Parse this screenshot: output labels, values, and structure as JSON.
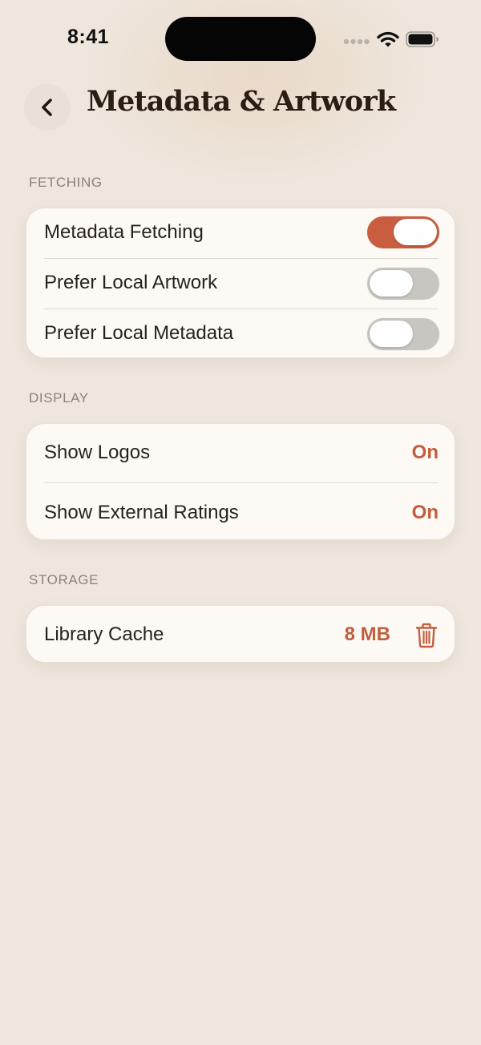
{
  "status_bar": {
    "time": "8:41",
    "icons": [
      "signal-dots-icon",
      "wifi-icon",
      "battery-icon"
    ]
  },
  "header": {
    "back_icon": "chevron-left-icon",
    "title": "Metadata & Artwork"
  },
  "sections": {
    "fetching": {
      "label": "FETCHING",
      "rows": [
        {
          "label": "Metadata Fetching",
          "enabled": true
        },
        {
          "label": "Prefer Local Artwork",
          "enabled": false
        },
        {
          "label": "Prefer Local Metadata",
          "enabled": false
        }
      ]
    },
    "display": {
      "label": "DISPLAY",
      "rows": [
        {
          "label": "Show Logos",
          "value": "On"
        },
        {
          "label": "Show External Ratings",
          "value": "On"
        }
      ]
    },
    "storage": {
      "label": "STORAGE",
      "rows": [
        {
          "label": "Library Cache",
          "value": "8 MB",
          "action_icon": "trash-icon"
        }
      ]
    }
  },
  "colors": {
    "background": "#efe7de",
    "card": "#fdfaf6",
    "accent": "#c85e3f",
    "toggle_off": "#c9c6c2",
    "section_label": "#8b827a",
    "title": "#2a1d15"
  }
}
